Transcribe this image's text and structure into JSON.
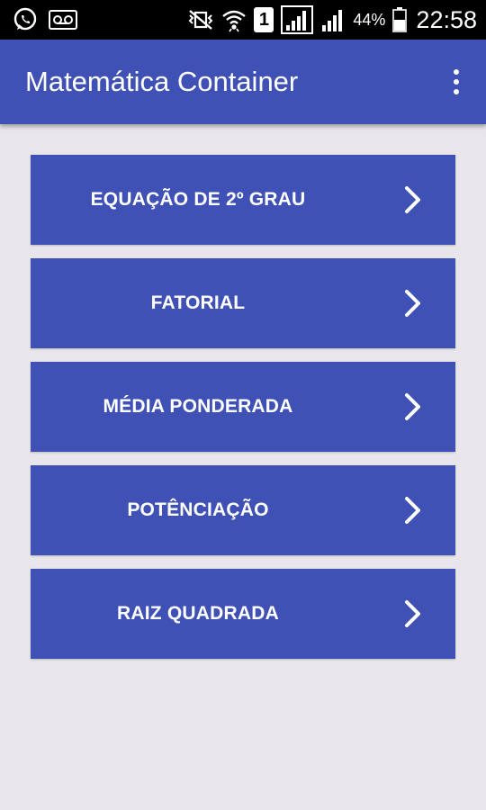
{
  "status_bar": {
    "icons_left": [
      "whatsapp-icon",
      "voicemail-icon"
    ],
    "icons_right": [
      "vibrate-silent-icon",
      "wifi-icon",
      "sim-1-icon",
      "signal-icon",
      "signal-icon-2",
      "battery-icon"
    ],
    "sim_label": "1",
    "battery": "44%",
    "time": "22:58"
  },
  "app_bar": {
    "title": "Matemática Container",
    "overflow_icon": "more-vert-icon",
    "color": "#3f51b5"
  },
  "menu": {
    "items": [
      {
        "label": "EQUAÇÃO DE 2º GRAU",
        "icon": "chevron-right-icon"
      },
      {
        "label": "FATORIAL",
        "icon": "chevron-right-icon"
      },
      {
        "label": "MÉDIA PONDERADA",
        "icon": "chevron-right-icon"
      },
      {
        "label": "POTÊNCIAÇÃO",
        "icon": "chevron-right-icon"
      },
      {
        "label": "RAIZ QUADRADA",
        "icon": "chevron-right-icon"
      }
    ]
  },
  "colors": {
    "primary": "#3f51b5",
    "background": "#e8e6ea",
    "status_bar": "#000000"
  }
}
